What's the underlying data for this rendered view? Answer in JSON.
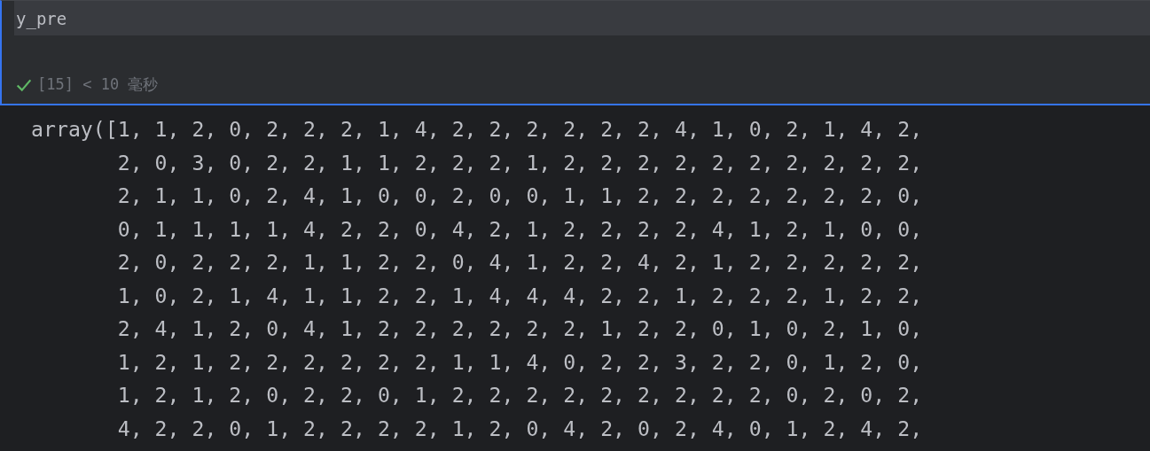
{
  "cell": {
    "code": "y_pre",
    "status": {
      "success": true,
      "text": "[15] < 10 毫秒"
    }
  },
  "output": {
    "lines": [
      "array([1, 1, 2, 0, 2, 2, 2, 1, 4, 2, 2, 2, 2, 2, 2, 4, 1, 0, 2, 1, 4, 2,",
      "2, 0, 3, 0, 2, 2, 1, 1, 2, 2, 2, 1, 2, 2, 2, 2, 2, 2, 2, 2, 2, 2,",
      "2, 1, 1, 0, 2, 4, 1, 0, 0, 2, 0, 0, 1, 1, 2, 2, 2, 2, 2, 2, 2, 0,",
      "0, 1, 1, 1, 1, 4, 2, 2, 0, 4, 2, 1, 2, 2, 2, 2, 4, 1, 2, 1, 0, 0,",
      "2, 0, 2, 2, 2, 1, 1, 2, 2, 0, 4, 1, 2, 2, 4, 2, 1, 2, 2, 2, 2, 2,",
      "1, 0, 2, 1, 4, 1, 1, 2, 2, 1, 4, 4, 4, 2, 2, 1, 2, 2, 2, 1, 2, 2,",
      "2, 4, 1, 2, 0, 4, 1, 2, 2, 2, 2, 2, 2, 1, 2, 2, 0, 1, 0, 2, 1, 0,",
      "1, 2, 1, 2, 2, 2, 2, 2, 2, 1, 1, 4, 0, 2, 2, 3, 2, 2, 0, 1, 2, 0,",
      "1, 2, 1, 2, 0, 2, 2, 0, 1, 2, 2, 2, 2, 2, 2, 2, 2, 2, 0, 2, 0, 2,",
      "4, 2, 2, 0, 1, 2, 2, 2, 2, 1, 2, 0, 4, 2, 0, 2, 4, 0, 1, 2, 4, 2,"
    ]
  }
}
